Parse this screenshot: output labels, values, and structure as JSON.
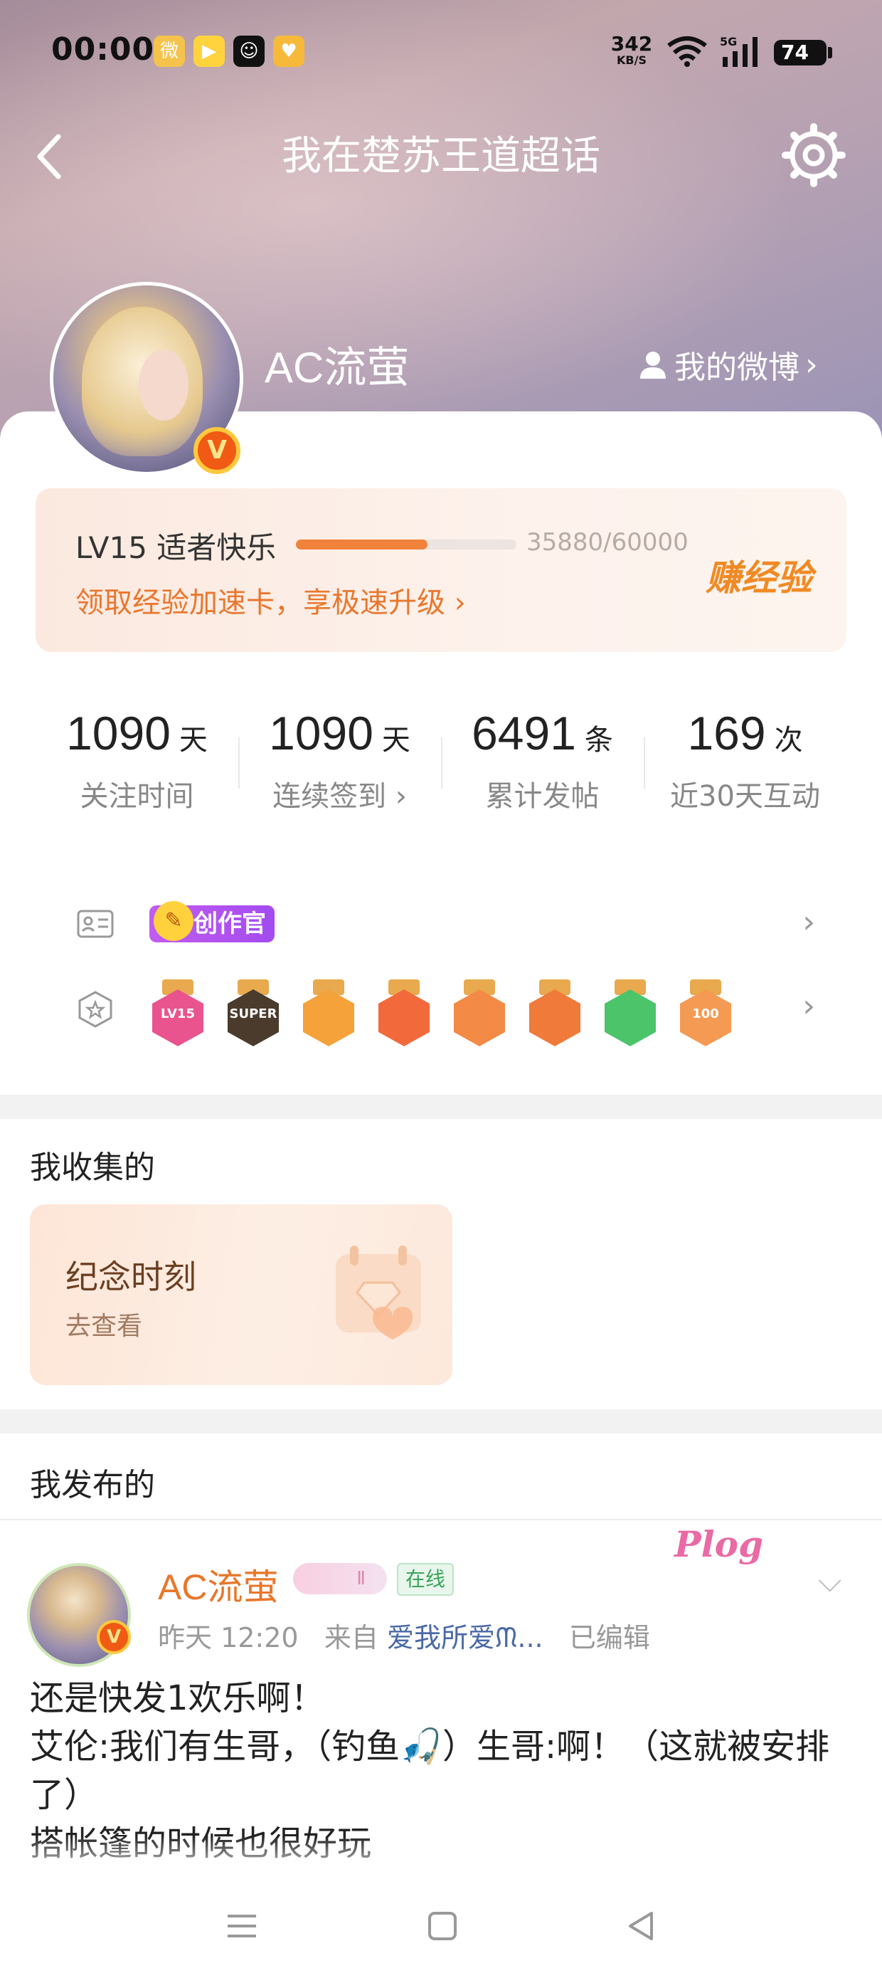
{
  "status_bar": {
    "time": "00:00",
    "net_speed": "342",
    "net_unit": "KB/S",
    "signal_label": "5G",
    "battery": "74",
    "apps": [
      "weibo-icon",
      "video-icon",
      "smile-icon",
      "heart-icon"
    ]
  },
  "nav": {
    "title": "我在楚苏王道超话"
  },
  "profile": {
    "username": "AC流萤",
    "my_weibo": "我的微博",
    "vip_letter": "V"
  },
  "level": {
    "label": "LV15 适者快乐",
    "exp": "35880/60000",
    "progress": 0.598,
    "link": "领取经验加速卡，享极速升级",
    "earn": "赚经验"
  },
  "stats": [
    {
      "value": "1090",
      "unit": "天",
      "label": "关注时间"
    },
    {
      "value": "1090",
      "unit": "天",
      "label": "连续签到 ›"
    },
    {
      "value": "6491",
      "unit": "条",
      "label": "累计发帖"
    },
    {
      "value": "169",
      "unit": "次",
      "label": "近30天互动"
    }
  ],
  "badges": {
    "creator_tag": "创作官",
    "medals": [
      {
        "name": "lv15-medal",
        "text": "LV15",
        "color": "#e9548e"
      },
      {
        "name": "super-medal",
        "text": "SUPER",
        "color": "#4a3b2c"
      },
      {
        "name": "crown-medal",
        "text": "",
        "color": "#f5a23a"
      },
      {
        "name": "rabbit-medal-1",
        "text": "",
        "color": "#f26a3c"
      },
      {
        "name": "rabbit-medal-2",
        "text": "",
        "color": "#f38a45"
      },
      {
        "name": "rabbit-medal-3",
        "text": "",
        "color": "#f07a3a"
      },
      {
        "name": "hand-medal",
        "text": "",
        "color": "#4cc46a"
      },
      {
        "name": "100days-medal",
        "text": "100",
        "color": "#f59a52"
      }
    ]
  },
  "collected": {
    "title": "我收集的",
    "card_title": "纪念时刻",
    "card_sub": "去查看"
  },
  "posted": {
    "title": "我发布的",
    "author": "AC流萤",
    "level_tag": "Ⅱ",
    "online": "在线",
    "time": "昨天 12:20",
    "from_label": "来自",
    "source": "爱我所爱ᙏ...",
    "edited": "已编辑",
    "sticker": "Plog",
    "body": "还是快发1欢乐啊！\n艾伦:我们有生哥，（钓鱼🎣）生哥:啊！（这就被安排了）\n搭帐篷的时候也很好玩"
  },
  "colors": {
    "accent": "#f1823b",
    "brand_orange": "#e8772a",
    "online_green": "#3aa35a"
  }
}
